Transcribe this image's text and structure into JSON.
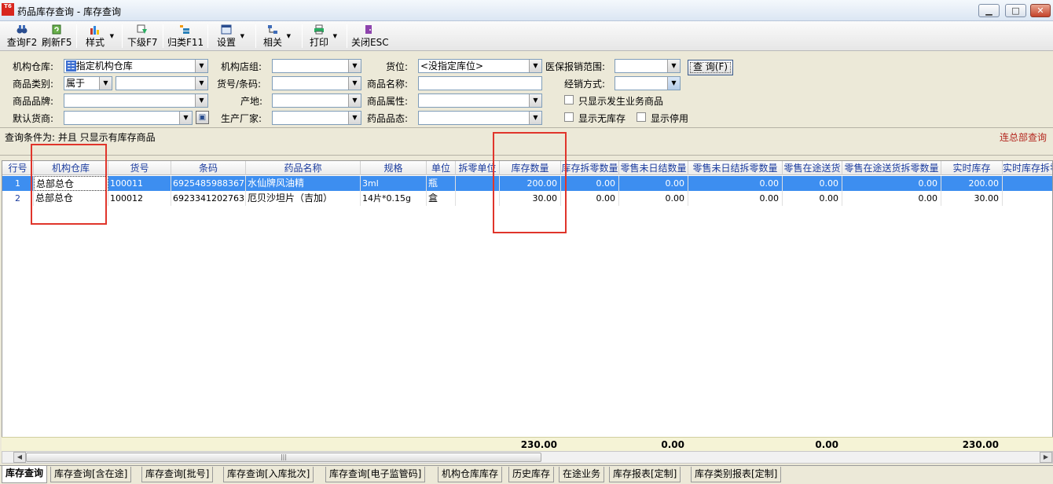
{
  "window": {
    "title": "药品库存查询 - 库存查询",
    "icon_text": "T6",
    "minimize": "▁",
    "maximize": "□",
    "close": "✕"
  },
  "toolbar": [
    {
      "label": "查询F2",
      "icon": "binoculars-icon"
    },
    {
      "label": "刷新F5",
      "icon": "refresh-icon"
    },
    {
      "label": "样式",
      "icon": "style-icon"
    },
    {
      "label": "下级F7",
      "icon": "drilldown-icon"
    },
    {
      "label": "归类F11",
      "icon": "category-icon"
    },
    {
      "label": "设置",
      "icon": "settings-icon"
    },
    {
      "label": "相关",
      "icon": "related-icon"
    },
    {
      "label": "打印",
      "icon": "printer-icon"
    },
    {
      "label": "关闭ESC",
      "icon": "close-door-icon"
    }
  ],
  "filters": {
    "warehouse_label": "机构仓库:",
    "warehouse_value": "指定机构仓库",
    "store_group_label": "机构店组:",
    "store_group_value": "",
    "location_label": "货位:",
    "location_value": "<没指定库位>",
    "insurance_label": "医保报销范围:",
    "insurance_value": "",
    "query_button": "查 询(F)",
    "category_label": "商品类别:",
    "category_mode": "属于",
    "category_value": "",
    "code_label": "货号/条码:",
    "code_value": "",
    "name_label": "商品名称:",
    "name_value": "",
    "dist_label": "经销方式:",
    "dist_value": "",
    "brand_label": "商品品牌:",
    "brand_value": "",
    "origin_label": "产地:",
    "origin_value": "",
    "attr_label": "商品属性:",
    "attr_value": "",
    "only_business_label": "只显示发生业务商品",
    "supplier_label": "默认货商:",
    "supplier_value": "",
    "maker_label": "生产厂家:",
    "maker_value": "",
    "state_label": "药品品态:",
    "state_value": "",
    "no_stock_label": "显示无库存",
    "disabled_label": "显示停用"
  },
  "condition": {
    "text": "查询条件为: 并且 只显示有库存商品",
    "link": "连总部查询"
  },
  "grid": {
    "columns": [
      "行号",
      "机构仓库",
      "货号",
      "条码",
      "药品名称",
      "规格",
      "单位",
      "拆零单位",
      "库存数量",
      "库存拆零数量",
      "零售未日结数量",
      "零售未日结拆零数量",
      "零售在途送货",
      "零售在途送货拆零数量",
      "实时库存",
      "实时库存拆零"
    ],
    "rows": [
      [
        "1",
        "总部总仓",
        "100011",
        "6925485988367",
        "水仙牌风油精",
        "3ml",
        "瓶",
        "",
        "200.00",
        "0.00",
        "0.00",
        "0.00",
        "0.00",
        "0.00",
        "200.00",
        ""
      ],
      [
        "2",
        "总部总仓",
        "100012",
        "6923341202763",
        "厄贝沙坦片（吉加）",
        "14片*0.15g",
        "盒",
        "",
        "30.00",
        "0.00",
        "0.00",
        "0.00",
        "0.00",
        "0.00",
        "30.00",
        ""
      ]
    ],
    "totals": {
      "stock": "230.00",
      "split": "0.00",
      "unsettled": "0.00",
      "transit": "0.00",
      "realtime": "230.00"
    }
  },
  "scrollbar": {
    "left": "◀",
    "right": "▶",
    "grip": "|||"
  },
  "tabs": [
    "库存查询",
    "库存查询[含在途]",
    "库存查询[批号]",
    "库存查询[入库批次]",
    "库存查询[电子监管码]",
    "机构仓库库存",
    "历史库存",
    "在途业务",
    "库存报表[定制]",
    "库存类别报表[定制]"
  ]
}
